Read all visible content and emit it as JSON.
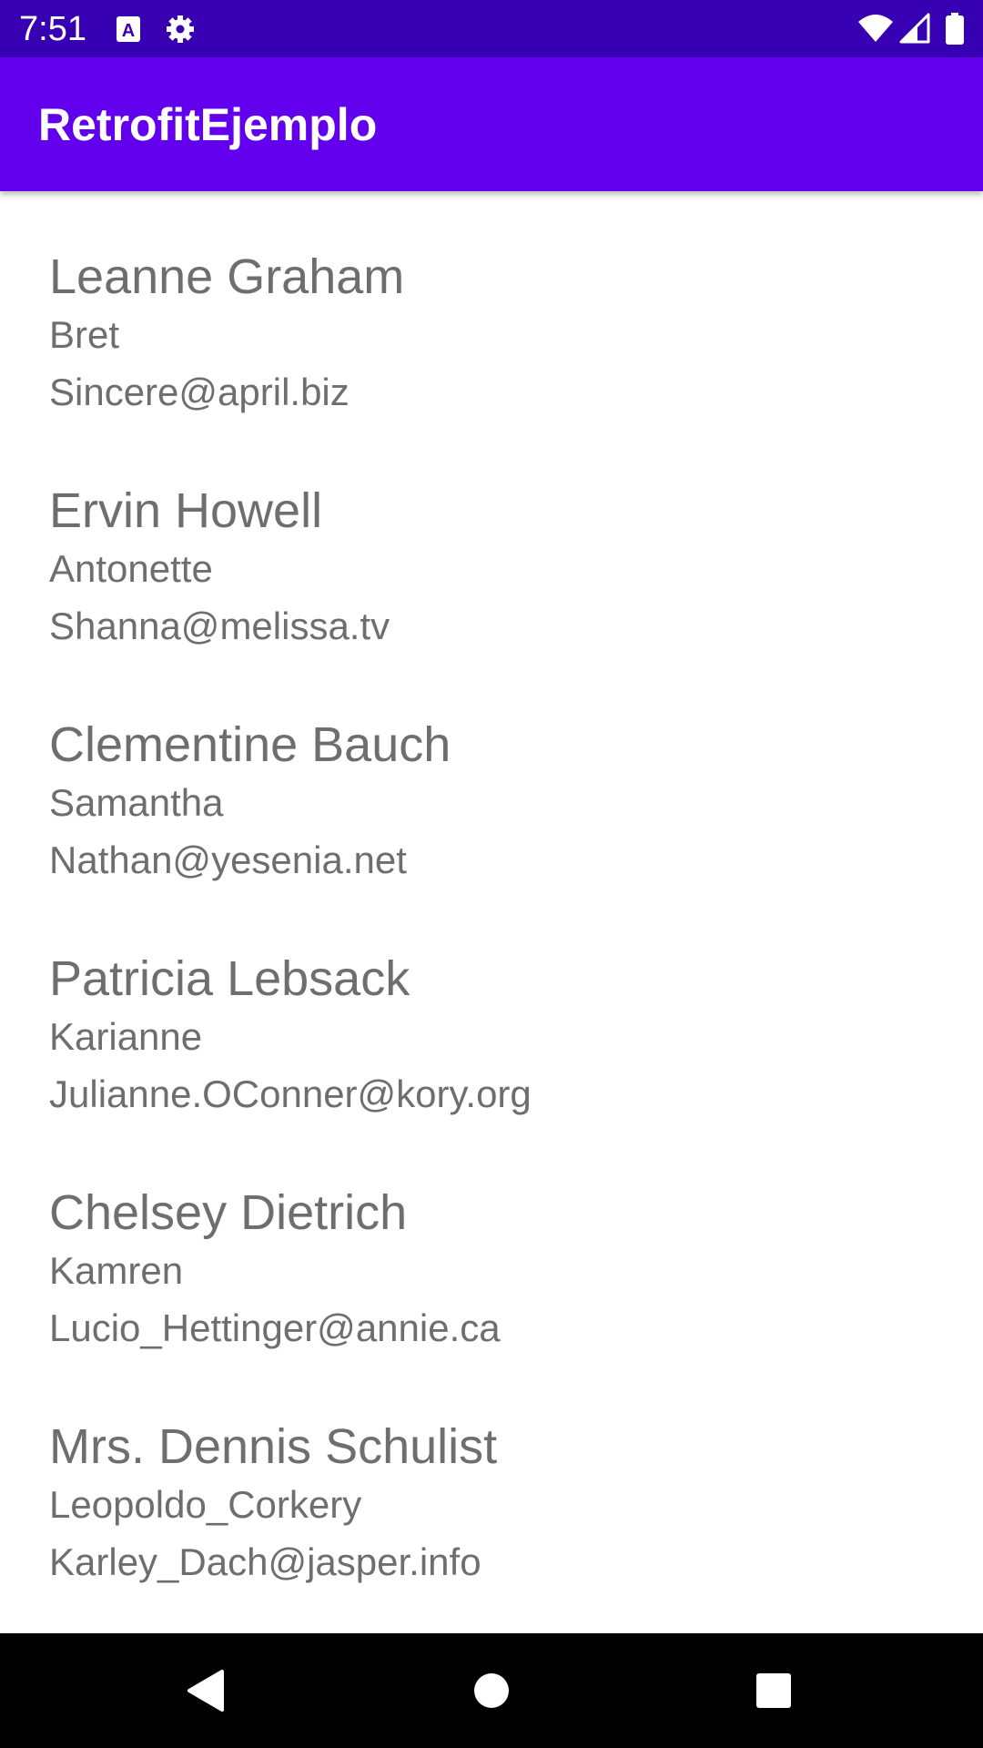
{
  "status_bar": {
    "time": "7:51",
    "left_icons": [
      "a-keyboard-icon",
      "gear-icon"
    ],
    "right_icons": [
      "wifi-icon",
      "cell-signal-icon",
      "battery-icon"
    ],
    "background": "#3700b3"
  },
  "app_bar": {
    "title": "RetrofitEjemplo",
    "background": "#6200ee"
  },
  "users": [
    {
      "name": "Leanne Graham",
      "username": "Bret",
      "email": "Sincere@april.biz"
    },
    {
      "name": "Ervin Howell",
      "username": "Antonette",
      "email": "Shanna@melissa.tv"
    },
    {
      "name": "Clementine Bauch",
      "username": "Samantha",
      "email": "Nathan@yesenia.net"
    },
    {
      "name": "Patricia Lebsack",
      "username": "Karianne",
      "email": "Julianne.OConner@kory.org"
    },
    {
      "name": "Chelsey Dietrich",
      "username": "Kamren",
      "email": "Lucio_Hettinger@annie.ca"
    },
    {
      "name": "Mrs. Dennis Schulist",
      "username": "Leopoldo_Corkery",
      "email": "Karley_Dach@jasper.info"
    }
  ],
  "nav_bar": {
    "buttons": [
      "back-icon",
      "home-icon",
      "recents-icon"
    ]
  }
}
